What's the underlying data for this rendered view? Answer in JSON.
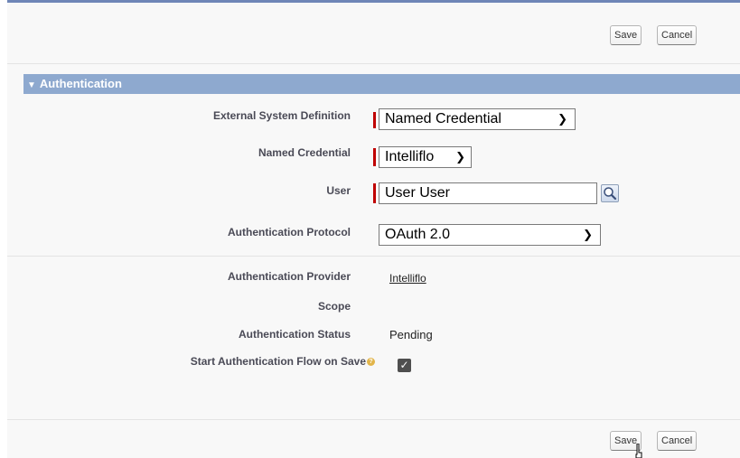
{
  "toolbar_top": {
    "save_label": "Save",
    "cancel_label": "Cancel"
  },
  "section": {
    "title": "Authentication"
  },
  "fields": {
    "external_system_definition": {
      "label": "External System Definition",
      "value": "Named Credential"
    },
    "named_credential": {
      "label": "Named Credential",
      "value": "Intelliflo"
    },
    "user": {
      "label": "User",
      "value": "User User"
    },
    "authentication_protocol": {
      "label": "Authentication Protocol",
      "value": "OAuth 2.0"
    },
    "authentication_provider": {
      "label": "Authentication Provider",
      "value": "Intelliflo"
    },
    "scope": {
      "label": "Scope",
      "value": ""
    },
    "authentication_status": {
      "label": "Authentication Status",
      "value": "Pending"
    },
    "start_auth_flow": {
      "label": "Start Authentication Flow on Save",
      "checked": true
    }
  },
  "toolbar_bottom": {
    "save_label": "Save",
    "cancel_label": "Cancel"
  },
  "icons": {
    "dropdown": "chevron-down-icon",
    "lookup": "magnifier-icon",
    "help": "help-icon",
    "check": "check-icon"
  },
  "colors": {
    "section_header": "#8ea9cf",
    "required": "#c00000",
    "top_border": "#6f86b7"
  }
}
